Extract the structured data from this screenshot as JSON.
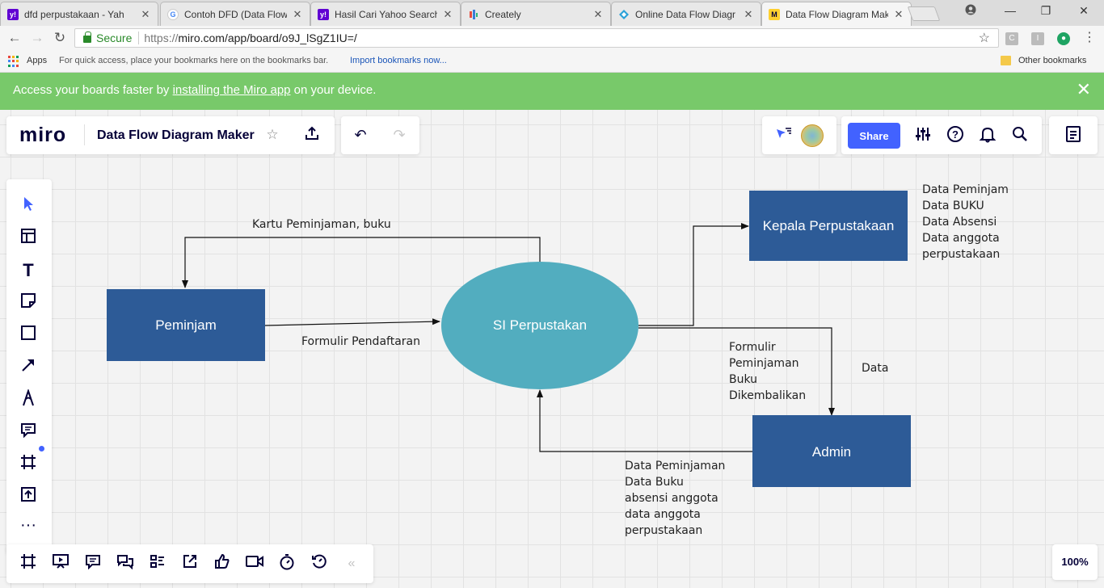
{
  "browser": {
    "tabs": [
      {
        "title": "dfd perpustakaan - Yah",
        "icon": "yahoo-icon",
        "color": "#6001d2"
      },
      {
        "title": "Contoh DFD (Data Flow",
        "icon": "google-icon",
        "color": "#4285f4"
      },
      {
        "title": "Hasil Cari Yahoo Search",
        "icon": "yahoo-icon",
        "color": "#6001d2"
      },
      {
        "title": "Creately",
        "icon": "creately-icon",
        "color": "#3b7dd8"
      },
      {
        "title": "Online Data Flow Diagr",
        "icon": "diamond-icon",
        "color": "#2aa1d8"
      },
      {
        "title": "Data Flow Diagram Mak",
        "icon": "miro-icon",
        "color": "#ffd02f"
      }
    ],
    "address": {
      "secure_label": "Secure",
      "url_scheme": "https://",
      "url_rest": "miro.com/app/board/o9J_lSgZ1IU=/"
    },
    "bookmarks": {
      "apps_label": "Apps",
      "hint": "For quick access, place your bookmarks here on the bookmarks bar.",
      "import_link": "Import bookmarks now...",
      "other": "Other bookmarks"
    }
  },
  "banner": {
    "before": "Access your boards faster by ",
    "link": "installing the Miro app",
    "after": " on your device.",
    "color": "#78c96a"
  },
  "miro": {
    "logo": "miro",
    "board_title": "Data Flow Diagram Maker",
    "share_label": "Share",
    "zoom": "100%",
    "accent": "#4262ff"
  },
  "diagram": {
    "colors": {
      "box": "#2d5b97",
      "process": "#52adbf"
    },
    "entities": {
      "peminjam": "Peminjam",
      "process": "SI Perpustakan",
      "kepala": "Kepala Perpustakaan",
      "admin": "Admin"
    },
    "flows": {
      "kartu": "Kartu Peminjaman, buku",
      "formulir_pendaftaran": "Formulir Pendaftaran",
      "formulir_peminjaman": [
        "Formulir",
        "Peminjaman",
        "Buku",
        "Dikembalikan"
      ],
      "data": "Data",
      "kepala_data": [
        "Data Peminjam",
        "Data BUKU",
        "Data Absensi",
        "Data anggota",
        "perpustakaan"
      ],
      "admin_data": [
        "Data Peminjaman",
        "Data Buku",
        "absensi anggota",
        "data anggota",
        "perpustakaan"
      ]
    }
  }
}
